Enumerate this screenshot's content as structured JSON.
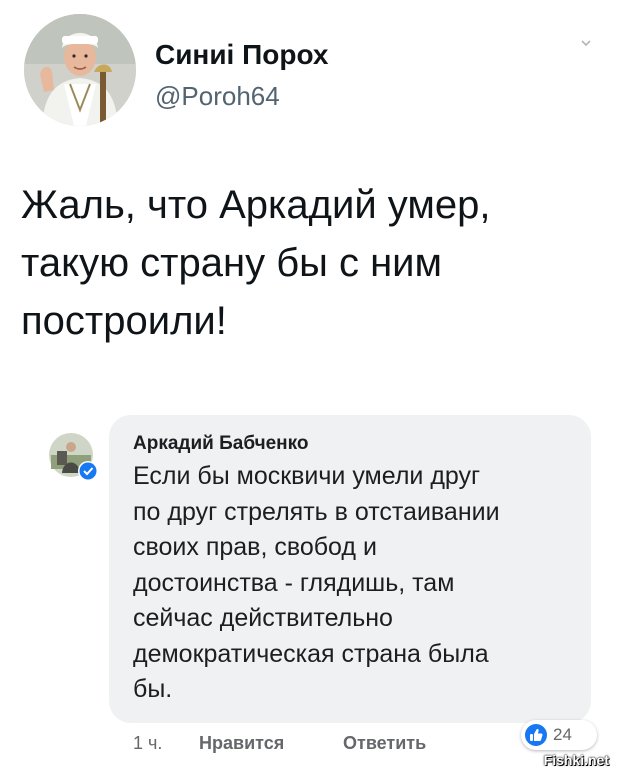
{
  "tweet": {
    "author_name": "Синиі Порох",
    "author_handle": "@Poroh64",
    "text": "Жаль, что Аркадий умер,\nтакую страну бы с ним\nпостроили!"
  },
  "comment": {
    "author": "Аркадий Бабченко",
    "text": "Если бы москвичи умели друг\nпо друг стрелять в отстаивании\nсвоих прав, свобод и\nдостоинства - глядишь, там\nсейчас действительно\nдемократическая страна была\nбы.",
    "time": "1 ч.",
    "like_label": "Нравится",
    "reply_label": "Ответить",
    "reaction_count": "24",
    "reaction_icon": "thumbs-up-icon"
  },
  "watermark": "Fishki.net",
  "colors": {
    "primary_text": "#0f1419",
    "secondary_text": "#536471",
    "bubble_bg": "#eff1f3",
    "facebook_blue": "#1877f2"
  }
}
